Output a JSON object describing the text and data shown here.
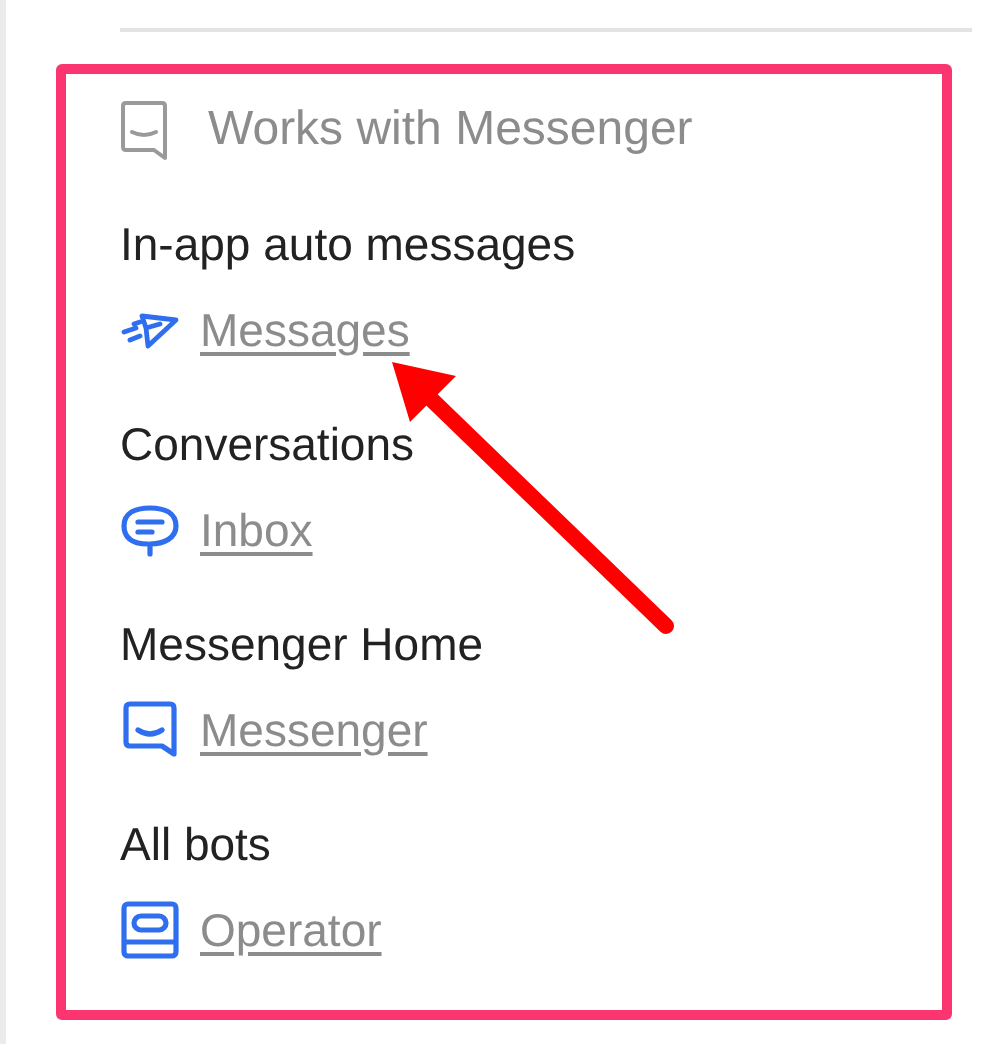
{
  "panel": {
    "title": "Works with Messenger",
    "sections": [
      {
        "label": "In-app auto messages",
        "link": {
          "text": "Messages",
          "kind": "send"
        }
      },
      {
        "label": "Conversations",
        "link": {
          "text": "Inbox",
          "kind": "chat"
        }
      },
      {
        "label": "Messenger Home",
        "link": {
          "text": "Messenger",
          "kind": "messenger"
        }
      },
      {
        "label": "All bots",
        "link": {
          "text": "Operator",
          "kind": "operator"
        }
      }
    ]
  }
}
